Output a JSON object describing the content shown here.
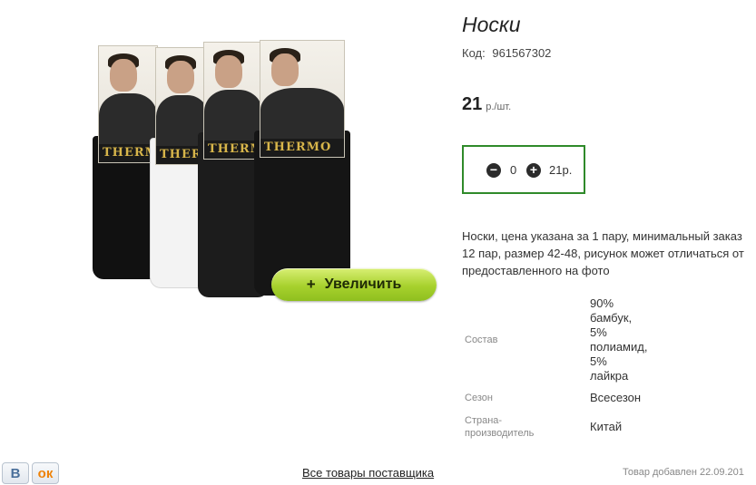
{
  "product": {
    "title": "Носки",
    "code_label": "Код:",
    "code_value": "961567302",
    "price_value": "21",
    "price_unit": "р./шт.",
    "description": "Носки, цена указана за 1 пару, минимальный заказ 12 пар, размер 42-48, рисунок может отличаться от предоставленного на фото",
    "image": {
      "brand_text": "THERMO",
      "packs": [
        "black",
        "white",
        "black",
        "black"
      ]
    },
    "zoom_button": {
      "icon": "+",
      "label": "Увеличить"
    }
  },
  "quantity": {
    "minus_icon": "minus-circle-icon",
    "value": "0",
    "plus_icon": "plus-circle-icon",
    "total": "21р."
  },
  "properties": [
    {
      "key": "Состав",
      "value": "90%\nбамбук,\n5%\nполиамид,\n5%\nлайкра"
    },
    {
      "key": "Сезон",
      "value": "Всесезон"
    },
    {
      "key": "Страна-\nпроизводитель",
      "value": "Китай"
    }
  ],
  "footer": {
    "social": [
      {
        "name": "vk",
        "glyph": "В",
        "color": "#4a6f9a"
      },
      {
        "name": "odnoklassniki",
        "glyph": "ок",
        "color": "#ee8208"
      }
    ],
    "all_products_link": "Все товары поставщика",
    "added_text": "Товар добавлен 22.09.201"
  }
}
